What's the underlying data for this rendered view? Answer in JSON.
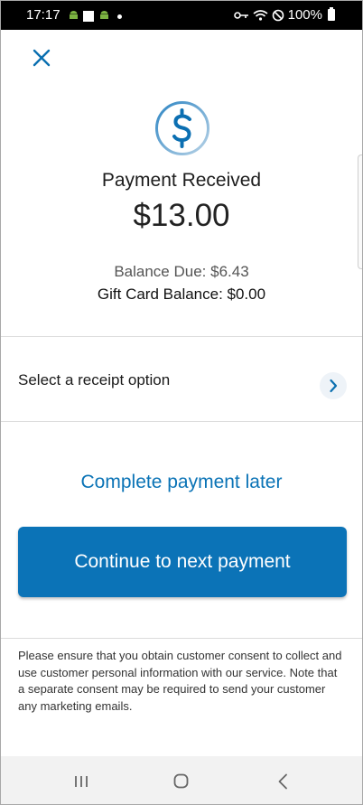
{
  "status_bar": {
    "time": "17:17",
    "battery": "100%"
  },
  "header": {
    "close_icon": "close-icon"
  },
  "payment": {
    "icon": "dollar-circle-icon",
    "title": "Payment Received",
    "amount": "$13.00",
    "balance_due": "Balance Due: $6.43",
    "gift_card_balance": "Gift Card Balance: $0.00"
  },
  "receipt": {
    "label": "Select a receipt option"
  },
  "actions": {
    "later_label": "Complete payment later",
    "continue_label": "Continue to next payment"
  },
  "footer": {
    "consent_text": "Please ensure that you obtain customer consent to collect and use customer personal information with our service. Note that a separate consent may be required to send your customer any marketing emails."
  },
  "colors": {
    "accent": "#0b73b7",
    "link": "#0a73b6"
  }
}
